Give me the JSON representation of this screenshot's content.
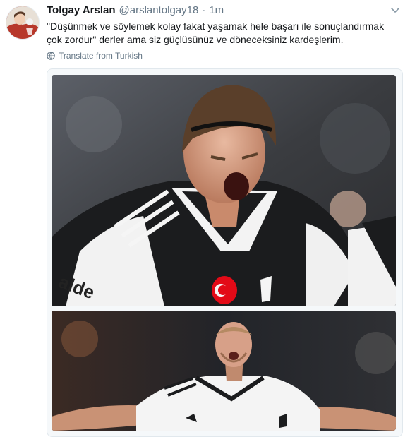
{
  "tweet": {
    "author_name": "Tolgay Arslan",
    "author_handle": "@arslantolgay18",
    "separator": "·",
    "timestamp": "1m",
    "text": "\"Düşünmek ve söylemek kolay fakat yaşamak hele başarı ile sonuçlandırmak çok zordur\" derler ama siz güçlüsünüz ve döneceksiniz kardeşlerim.",
    "translate_label": "Translate from Turkish",
    "photos": [
      {
        "jersey_sponsor": "alde"
      },
      {}
    ]
  },
  "icons": {
    "globe": "globe-icon",
    "caret": "chevron-down-icon"
  },
  "colors": {
    "text": "#14171a",
    "secondary": "#657786",
    "border": "#e1e8ed",
    "turkey_red": "#e30a17"
  }
}
